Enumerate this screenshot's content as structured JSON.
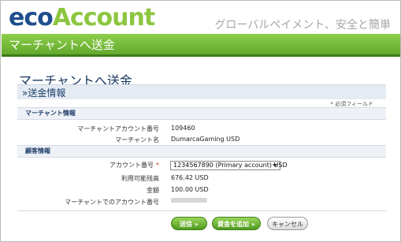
{
  "header": {
    "logo_eco": "eco",
    "logo_account": "Account",
    "tagline": "グローバルペイメント、安全と簡単",
    "banner_title": "マーチャントへ送金"
  },
  "page": {
    "title": "マーチャントへ送金",
    "section_title": "»送金情報",
    "required_note": "* 必須フィールド"
  },
  "merchant_info": {
    "header": "マーチャント情報",
    "account_number_label": "マーチャントアカウント番号",
    "account_number_value": "109460",
    "name_label": "マーチャント名",
    "name_value": "DumarcaGaming USD"
  },
  "customer_info": {
    "header": "顧客情報",
    "account_label": "アカウント番号",
    "required_mark": "*",
    "account_selected": "1234567890 (Primary account) USD",
    "available_label": "利用可能残高",
    "available_value": "676.42 USD",
    "amount_label": "金額",
    "amount_value": "100.00 USD",
    "merchant_account_label": "マーチャントでのアカウント番号"
  },
  "buttons": {
    "send": "送信 »",
    "add_funds": "資金を追加 »",
    "cancel": "キャンセル"
  },
  "colors": {
    "brand_blue": "#1f4e8c",
    "brand_green": "#8cc63f",
    "banner_green": "#63a92c"
  }
}
